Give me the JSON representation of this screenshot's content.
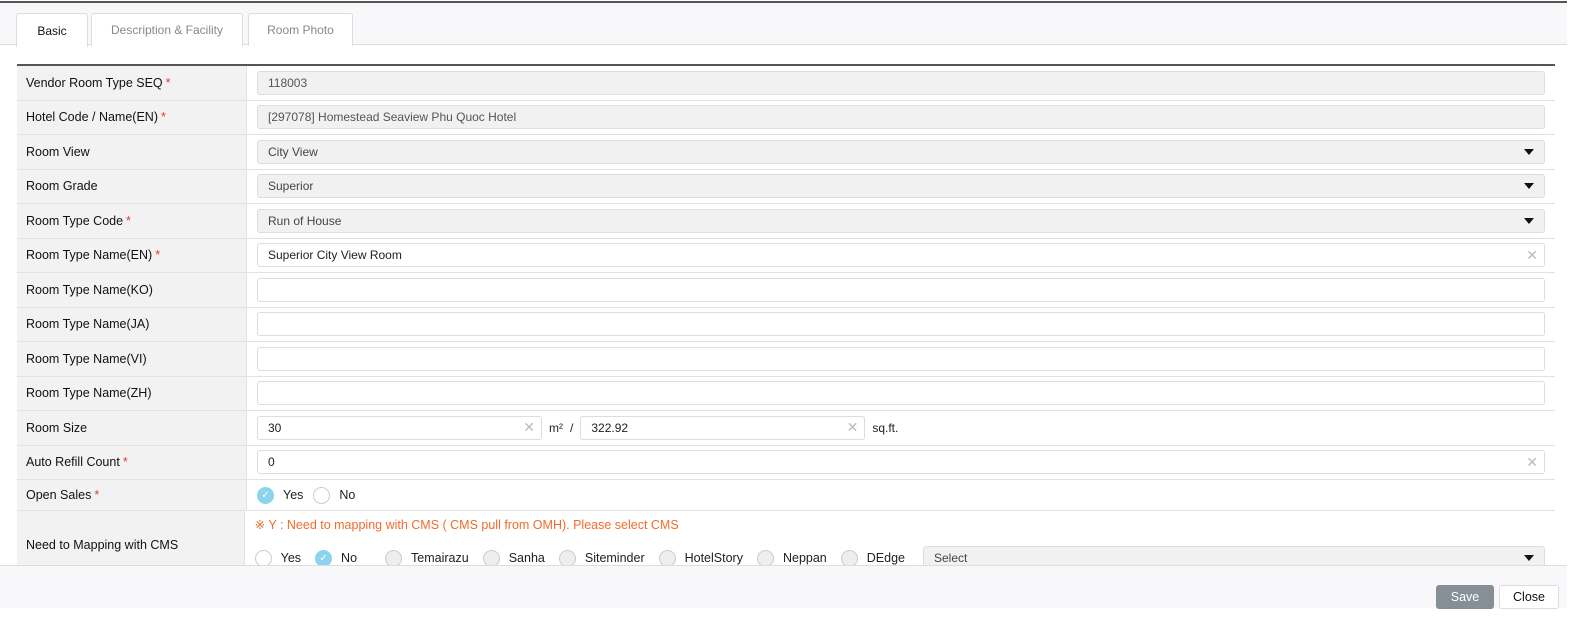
{
  "tabs": [
    "Basic",
    "Description & Facility",
    "Room Photo"
  ],
  "fields": {
    "seq": {
      "label": "Vendor Room Type SEQ",
      "value": "118003"
    },
    "hotel": {
      "label": "Hotel Code / Name(EN)",
      "value": "[297078] Homestead Seaview Phu Quoc Hotel"
    },
    "view": {
      "label": "Room View",
      "value": "City View"
    },
    "grade": {
      "label": "Room Grade",
      "value": "Superior"
    },
    "code": {
      "label": "Room Type Code",
      "value": "Run of House"
    },
    "name_en": {
      "label": "Room Type Name(EN)",
      "value": "Superior City View Room"
    },
    "name_ko": {
      "label": "Room Type Name(KO)",
      "value": ""
    },
    "name_ja": {
      "label": "Room Type Name(JA)",
      "value": ""
    },
    "name_vi": {
      "label": "Room Type Name(VI)",
      "value": ""
    },
    "name_zh": {
      "label": "Room Type Name(ZH)",
      "value": ""
    },
    "size": {
      "label": "Room Size",
      "m2": "30",
      "m2_unit": "m²",
      "sep": "/",
      "sqft": "322.92",
      "sqft_unit": "sq.ft."
    },
    "refill": {
      "label": "Auto Refill Count",
      "value": "0"
    },
    "open_sales": {
      "label": "Open Sales",
      "options": [
        "Yes",
        "No"
      ],
      "selected": "Yes"
    },
    "cms": {
      "label": "Need to Mapping with CMS",
      "note": "※ Y : Need to mapping with CMS ( CMS pull from OMH). Please select CMS",
      "options": [
        "Yes",
        "No"
      ],
      "selected": "No",
      "providers": [
        "Temairazu",
        "Sanha",
        "Siteminder",
        "HotelStory",
        "Neppan",
        "DEdge"
      ],
      "select_placeholder": "Select"
    }
  },
  "required": "*",
  "buttons": {
    "save": "Save",
    "close": "Close"
  }
}
